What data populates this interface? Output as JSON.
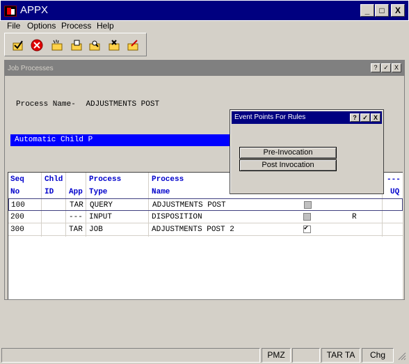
{
  "app": {
    "title": "APPX"
  },
  "menu": [
    "File",
    "Options",
    "Process",
    "Help"
  ],
  "window_buttons": [
    "_",
    "□",
    "X"
  ],
  "toolbar": {
    "icons": [
      "check-icon",
      "cancel-icon",
      "folder-new-icon",
      "folder-open-icon",
      "folder-search-icon",
      "folder-delete-icon",
      "folder-edit-icon"
    ]
  },
  "job_window": {
    "title": "Job Processes",
    "buttons": [
      "?",
      "✓",
      "X"
    ],
    "process_name_label": "Process Name-",
    "process_name_value": "ADJUSTMENTS POST",
    "highlight_bar": "Automatic Child P"
  },
  "grid": {
    "headers": [
      {
        "line1": "Seq",
        "line2": "No"
      },
      {
        "line1": "Chld",
        "line2": "ID"
      },
      {
        "line1": "",
        "line2": "App"
      },
      {
        "line1": "Process",
        "line2": "Type"
      },
      {
        "line1": "Process",
        "line2": "Name"
      },
      {
        "line1": "---",
        "line2": "UQ"
      }
    ],
    "rows": [
      {
        "seq": "100",
        "chld": "",
        "app": "TAR",
        "type": "QUERY",
        "name": "ADJUSTMENTS POST",
        "checked": false,
        "flag": ""
      },
      {
        "seq": "200",
        "chld": "",
        "app": "---",
        "type": "INPUT",
        "name": "DISPOSITION",
        "checked": false,
        "flag": "R"
      },
      {
        "seq": "300",
        "chld": "",
        "app": "TAR",
        "type": "JOB",
        "name": "ADJUSTMENTS POST 2",
        "checked": true,
        "flag": ""
      }
    ]
  },
  "dialog": {
    "title": "Event Points For Rules",
    "buttons": [
      "?",
      "✓",
      "X"
    ],
    "pre_label": "Pre-Invocation",
    "post_label": "Post Invocation"
  },
  "status": [
    "PMZ",
    "TAR TA",
    "Chg"
  ]
}
